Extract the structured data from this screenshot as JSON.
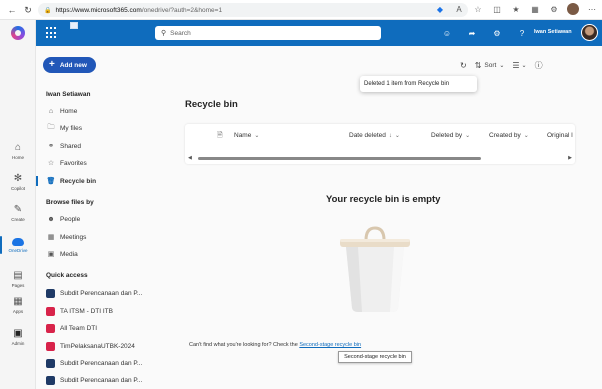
{
  "browser": {
    "url_host": "https://www.microsoft365.com",
    "url_rest": "/onedrive/?auth=2&home=1"
  },
  "rail": {
    "items": [
      {
        "label": "Home",
        "icon": "home-icon"
      },
      {
        "label": "Copilot",
        "icon": "copilot-icon"
      },
      {
        "label": "Create",
        "icon": "create-icon"
      },
      {
        "label": "OneDrive",
        "icon": "onedrive-icon"
      },
      {
        "label": "Pages",
        "icon": "pages-icon"
      },
      {
        "label": "Apps",
        "icon": "apps-icon"
      },
      {
        "label": "Admin",
        "icon": "admin-icon"
      }
    ]
  },
  "header": {
    "search_placeholder": "Search",
    "user_name": "Iwan Setiawan"
  },
  "leftnav": {
    "new_label": "Add new",
    "owner": "Iwan Setiawan",
    "items": [
      {
        "label": "Home"
      },
      {
        "label": "My files"
      },
      {
        "label": "Shared"
      },
      {
        "label": "Favorites"
      },
      {
        "label": "Recycle bin"
      }
    ],
    "browse_title": "Browse files by",
    "browse": [
      {
        "label": "People"
      },
      {
        "label": "Meetings"
      },
      {
        "label": "Media"
      }
    ],
    "quick_title": "Quick access",
    "quick": [
      {
        "label": "Subdit Perencanaan dan P...",
        "color": "#1f3a66"
      },
      {
        "label": "TA ITSM - DTI ITB",
        "color": "#d8234a"
      },
      {
        "label": "All Team DTI",
        "color": "#d8234a"
      },
      {
        "label": "TimPelaksanaUTBK-2024",
        "color": "#d8234a"
      },
      {
        "label": "Subdit Perencanaan dan P...",
        "color": "#1f3a66"
      },
      {
        "label": "Subdit Perencanaan dan P...",
        "color": "#1f3a66"
      }
    ]
  },
  "main": {
    "sort_label": "Sort",
    "toast": "Deleted 1 item from Recycle bin",
    "title": "Recycle bin",
    "columns": {
      "name": "Name",
      "date_deleted": "Date deleted",
      "deleted_by": "Deleted by",
      "created_by": "Created by",
      "original": "Original l"
    },
    "empty_title": "Your recycle bin is empty",
    "footer_prefix": "Can't find what you're looking for? Check the ",
    "footer_link": "Second-stage recycle bin",
    "tooltip": "Second-stage recycle bin"
  },
  "colors": {
    "brand_blue": "#0f6cbd",
    "new_button": "#2157b8"
  }
}
